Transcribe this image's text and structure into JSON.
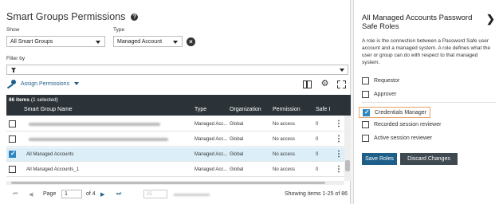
{
  "page": {
    "title": "Smart Groups Permissions",
    "show_label": "Show",
    "show_value": "All Smart Groups",
    "type_label": "Type",
    "type_value": "Managed Account",
    "filter_label": "Filter by"
  },
  "toolbar": {
    "assign_label": "Assign Permissions"
  },
  "grid": {
    "items_count": "86 items",
    "selected_count": "(1 selected)",
    "columns": [
      "Smart Group Name",
      "Type",
      "Organization",
      "Permission",
      "Safe I"
    ],
    "rows": [
      {
        "name": "",
        "type": "Managed Acc...",
        "org": "Global",
        "permission": "No access",
        "safe": "0",
        "checked": false
      },
      {
        "name": "",
        "type": "Managed Acc...",
        "org": "Global",
        "permission": "No access",
        "safe": "0",
        "checked": false
      },
      {
        "name": "All Managed Accounts",
        "type": "Managed Acc...",
        "org": "Global",
        "permission": "No access",
        "safe": "0",
        "checked": true
      },
      {
        "name": "All Managed Accounts_1",
        "type": "Managed Acc...",
        "org": "Global",
        "permission": "No access",
        "safe": "0",
        "checked": false
      }
    ]
  },
  "pager": {
    "page_label": "Page",
    "page_value": "1",
    "of_label": "of 4",
    "per_page": "25",
    "summary": "Showing items 1-25 of 86"
  },
  "roles_panel": {
    "title": "All Managed Accounts Password Safe Roles",
    "description": "A role is the connection between a Password Safe user account and a managed system. A role defines what the user or group can do with respect to that managed system.",
    "roles": [
      {
        "label": "Requestor",
        "checked": false
      },
      {
        "label": "Approver",
        "checked": false
      },
      {
        "label": "Credentials Manager",
        "checked": true
      },
      {
        "label": "Recorded session reviewer",
        "checked": false
      },
      {
        "label": "Active session reviewer",
        "checked": false
      }
    ],
    "save_label": "Save Roles",
    "discard_label": "Discard Changes"
  },
  "colors": {
    "accent": "#1e5f8a",
    "header_bg": "#2c3338",
    "selected_row": "#dceef8",
    "highlight_border": "#e6a36b"
  }
}
